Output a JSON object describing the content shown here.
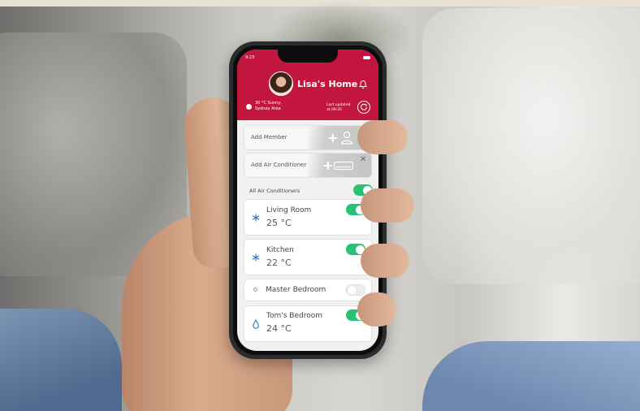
{
  "status_bar": {
    "time": "9:23"
  },
  "header": {
    "title": "Lisa's Home",
    "weather_line1": "30 °C Sunny,",
    "weather_line2": "Sydney Area",
    "updated_line1": "Last updated",
    "updated_line2": "at 09:20"
  },
  "add_member": {
    "label": "Add Member",
    "close": "✕"
  },
  "add_ac": {
    "label": "Add Air Conditioner",
    "close": "✕"
  },
  "all_ac": {
    "label": "All Air Conditioners",
    "on": true
  },
  "rooms": [
    {
      "name": "Living Room",
      "temp": "25 °C",
      "icon": "snowflake-icon",
      "on": true
    },
    {
      "name": "Kitchen",
      "temp": "22 °C",
      "icon": "snowflake-icon",
      "on": true
    },
    {
      "name": "Master Bedroom",
      "temp": "",
      "icon": "circle-icon",
      "on": false
    },
    {
      "name": "Tom's Bedroom",
      "temp": "24 °C",
      "icon": "droplet-icon",
      "on": true
    }
  ],
  "colors": {
    "brand": "#c3163f",
    "toggle_on": "#29c275",
    "icon_blue": "#2b6fc6"
  }
}
